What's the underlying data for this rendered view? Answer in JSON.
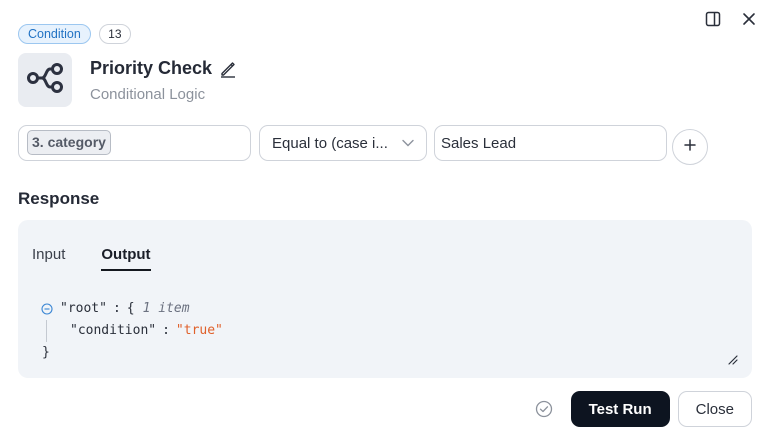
{
  "header": {
    "type_badge": "Condition",
    "count_badge": "13",
    "icons": {
      "panel": "split-panel-icon",
      "close": "close-icon"
    }
  },
  "node": {
    "icon": "branch-icon",
    "title": "Priority Check",
    "subtitle": "Conditional Logic"
  },
  "condition": {
    "variable": "3. category",
    "operator": "Equal to (case i...",
    "value": "Sales Lead"
  },
  "response": {
    "heading": "Response",
    "tabs": [
      {
        "label": "Input",
        "active": false
      },
      {
        "label": "Output",
        "active": true
      }
    ],
    "json": {
      "root_key": "\"root\"",
      "separator": ":",
      "open_brace": "{",
      "meta": "1 item",
      "entry_key": "\"condition\"",
      "entry_value": "\"true\"",
      "close_brace": "}"
    }
  },
  "footer": {
    "test_run_label": "Test Run",
    "close_label": "Close"
  },
  "colors": {
    "primary": "#0d1420",
    "badge_blue": "#2273c4",
    "json_string": "#e0602a",
    "panel_bg": "#f1f4f8"
  }
}
